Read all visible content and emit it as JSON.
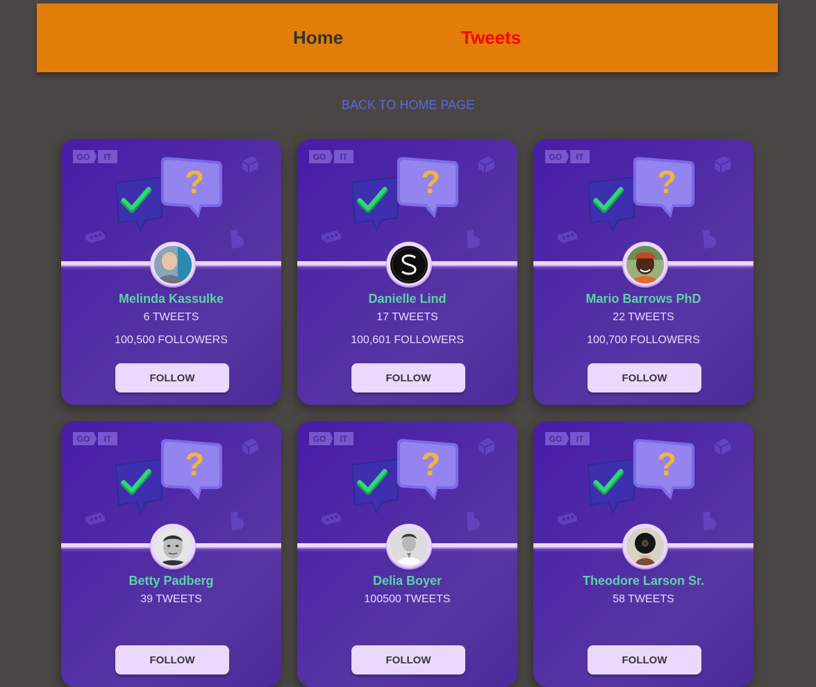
{
  "header": {
    "home_label": "Home",
    "tweets_label": "Tweets",
    "background": "#e37d09",
    "active_color": "#ff0000"
  },
  "back_link": {
    "label": "BACK TO HOME PAGE",
    "color": "#5a67e0"
  },
  "card_logo_text": {
    "left": "GO",
    "right": "IT"
  },
  "cards": [
    {
      "name": "Melinda Kassulke",
      "tweets": "6 TWEETS",
      "followers": "100,500 FOLLOWERS",
      "button": "FOLLOW",
      "avatar": "person-photo-icon"
    },
    {
      "name": "Danielle Lind",
      "tweets": "17 TWEETS",
      "followers": "100,601 FOLLOWERS",
      "button": "FOLLOW",
      "avatar": "logo-s-icon"
    },
    {
      "name": "Mario Barrows PhD",
      "tweets": "22 TWEETS",
      "followers": "100,700 FOLLOWERS",
      "button": "FOLLOW",
      "avatar": "person-photo-icon"
    },
    {
      "name": "Betty Padberg",
      "tweets": "39 TWEETS",
      "button": "FOLLOW",
      "avatar": "person-photo-icon"
    },
    {
      "name": "Delia Boyer",
      "tweets": "100500 TWEETS",
      "button": "FOLLOW",
      "avatar": "person-photo-icon"
    },
    {
      "name": "Theodore Larson Sr.",
      "tweets": "58 TWEETS",
      "button": "FOLLOW",
      "avatar": "person-photo-icon"
    }
  ],
  "colors": {
    "card_bg": "#471ca9",
    "name": "#5cd3a8",
    "text": "#ebd8ff",
    "button_bg": "#ebd8ff"
  }
}
